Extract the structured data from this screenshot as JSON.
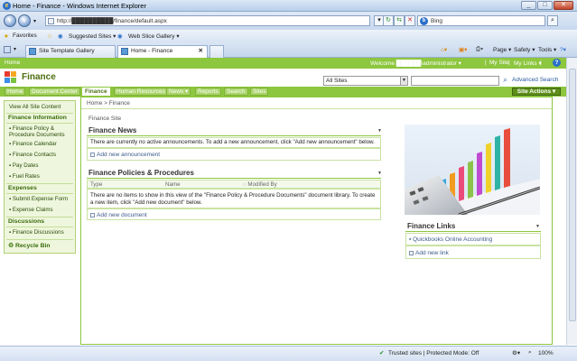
{
  "browser": {
    "title": "Home - Finance - Windows Internet Explorer",
    "address": "http://██████████/finance/default.aspx",
    "search_engine": "Bing",
    "favorites_label": "Favorites",
    "suggested_sites": "Suggested Sites ▾",
    "web_slice_gallery": "Web Slice Gallery ▾",
    "tabs": [
      "Site Template Gallery",
      "Home - Finance"
    ],
    "commands": [
      "Page ▾",
      "Safety ▾",
      "Tools ▾"
    ]
  },
  "sharepoint": {
    "top_home": "Home",
    "welcome": "Welcome ██████\\administrator ▾",
    "my_site": "My Site",
    "my_links": "My Links ▾",
    "site_title": "Finance",
    "scope": "All Sites",
    "advanced_search": "Advanced Search",
    "nav_tabs": [
      "Home",
      "Document Center",
      "Finance",
      "Human Resources",
      "News ▾",
      "Reports",
      "Search",
      "Sites"
    ],
    "site_actions": "Site Actions ▾",
    "breadcrumb": "Home > Finance",
    "site_label": "Finance Site"
  },
  "left_nav": {
    "view_all": "View All Site Content",
    "sections": [
      {
        "heading": "Finance Information",
        "items": [
          "Finance Policy & Procedure Documents",
          "Finance Calendar",
          "Finance Contacts",
          "Pay Dates",
          "Fuel Rates"
        ]
      },
      {
        "heading": "Expenses",
        "items": [
          "Submit Expense Form",
          "Expense Claims"
        ]
      },
      {
        "heading": "Discussions",
        "items": [
          "Finance Discussions"
        ]
      }
    ],
    "recycle_bin": "Recycle Bin"
  },
  "webparts": {
    "news": {
      "title": "Finance News",
      "empty": "There are currently no active announcements. To add a new announcement, click \"Add new announcement\" below.",
      "add": "Add new announcement"
    },
    "policies": {
      "title": "Finance Policies & Procedures",
      "columns": [
        "Type",
        "Name",
        "Modified By"
      ],
      "empty": "There are no items to show in this view of the \"Finance Policy & Procedure Documents\" document library. To create a new item, click \"Add new document\" below.",
      "add": "Add new document"
    },
    "links": {
      "title": "Finance Links",
      "items": [
        "Quickbooks Online Accounting"
      ],
      "add": "Add new link"
    }
  },
  "status_bar": {
    "zone": "Trusted sites | Protected Mode: Off",
    "zoom": "100%"
  },
  "colors": {
    "brand_green": "#8dc63f",
    "dark_green": "#4d6d0f",
    "link_blue": "#3c5a8a"
  }
}
